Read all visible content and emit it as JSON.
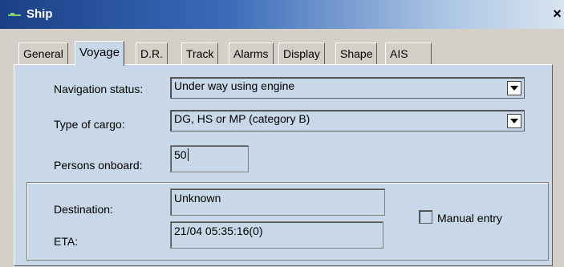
{
  "window": {
    "title": "Ship",
    "close_glyph": "×"
  },
  "tabs": [
    {
      "label": "General",
      "active": false
    },
    {
      "label": "Voyage",
      "active": true
    },
    {
      "label": "D.R.",
      "active": false
    },
    {
      "label": "Track",
      "active": false
    },
    {
      "label": "Alarms",
      "active": false
    },
    {
      "label": "Display",
      "active": false
    },
    {
      "label": "Shape",
      "active": false
    },
    {
      "label": "AIS",
      "active": false
    }
  ],
  "voyage": {
    "navigation_status_label": "Navigation status:",
    "navigation_status_value": "Under way using engine",
    "cargo_label": "Type of cargo:",
    "cargo_value": "DG, HS or MP (category B)",
    "persons_label": "Persons onboard:",
    "persons_value": "50",
    "destination_label": "Destination:",
    "destination_value": "Unknown",
    "eta_label": "ETA:",
    "eta_value": "21/04 05:35:16(0)",
    "manual_entry_label": "Manual entry",
    "manual_entry_checked": false
  },
  "icons": {
    "title": "ship-icon",
    "dropdown": "chevron-down-icon"
  }
}
